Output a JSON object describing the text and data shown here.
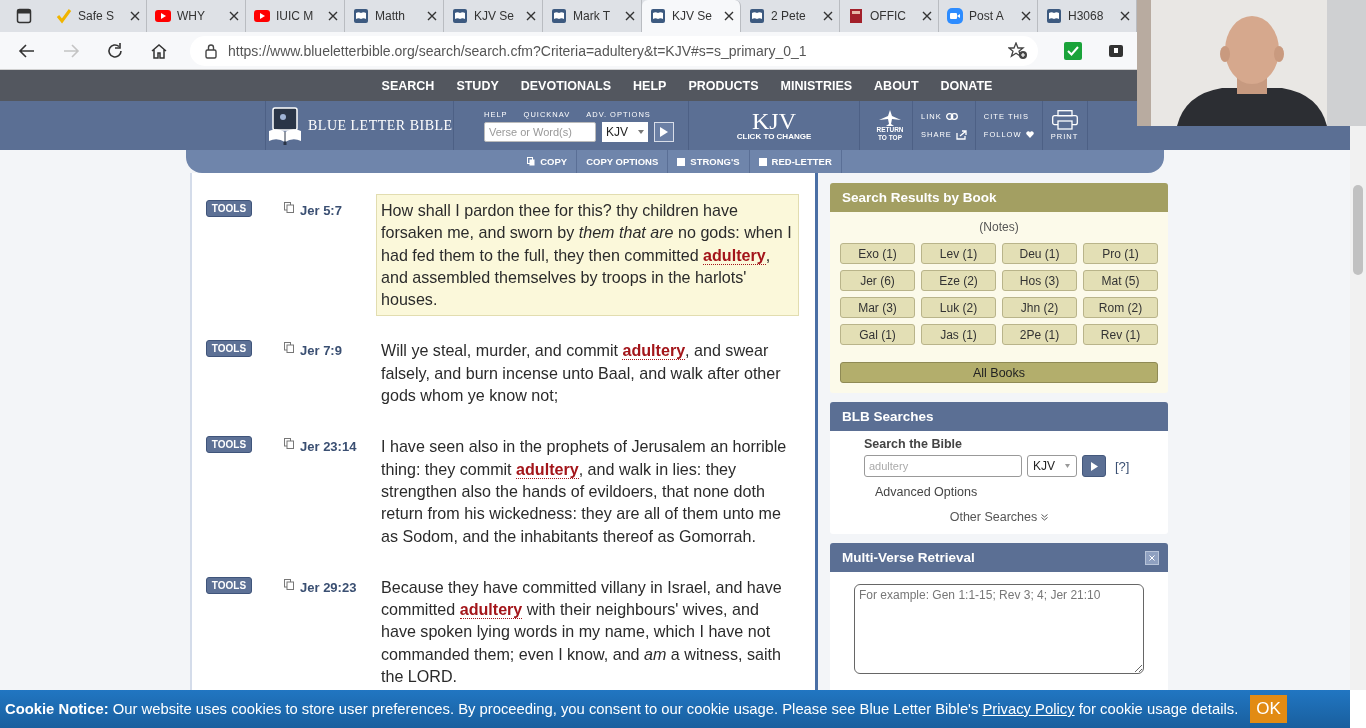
{
  "browser": {
    "tabs": [
      {
        "title": "Safe S",
        "kind": "check",
        "selected": false
      },
      {
        "title": "WHY",
        "kind": "video",
        "selected": false
      },
      {
        "title": "IUIC M",
        "kind": "video",
        "selected": false
      },
      {
        "title": "Matth",
        "kind": "bible",
        "selected": false
      },
      {
        "title": "KJV Se",
        "kind": "bible",
        "selected": false
      },
      {
        "title": "Mark T",
        "kind": "bible",
        "selected": false
      },
      {
        "title": "KJV Se",
        "kind": "bible",
        "selected": true
      },
      {
        "title": "2 Pete",
        "kind": "bible",
        "selected": false
      },
      {
        "title": "OFFIC",
        "kind": "book",
        "selected": false
      },
      {
        "title": "Post A",
        "kind": "meeting",
        "selected": false
      },
      {
        "title": "H3068",
        "kind": "bible",
        "selected": false
      }
    ],
    "url": "https://www.blueletterbible.org/search/search.cfm?Criteria=adultery&t=KJV#s=s_primary_0_1"
  },
  "site_nav": [
    "SEARCH",
    "STUDY",
    "DEVOTIONALS",
    "HELP",
    "PRODUCTS",
    "MINISTRIES",
    "ABOUT",
    "DONATE"
  ],
  "header": {
    "logo": "BLUE LETTER BIBLE",
    "quick_labels": [
      "HELP",
      "QUICKNAV",
      "ADV. OPTIONS"
    ],
    "placeholder": "Verse or Word(s)",
    "version": "KJV",
    "version_big": "KJV",
    "version_sub": "CLICK TO CHANGE",
    "return_to_top": "RETURN TO TOP",
    "link": "LINK",
    "share": "SHARE",
    "cite": "CITE THIS",
    "follow": "FOLLOW",
    "print": "PRINT"
  },
  "toolbar": [
    {
      "label": "COPY",
      "kind": "copy"
    },
    {
      "label": "COPY OPTIONS",
      "kind": "plain"
    },
    {
      "label": "STRONG'S",
      "kind": "checkbox",
      "checked": false
    },
    {
      "label": "RED-LETTER",
      "kind": "checkbox",
      "checked": false
    }
  ],
  "verses": [
    {
      "tools": "TOOLS",
      "ref": "Jer 5:7",
      "highlighted": true,
      "text": "How shall I pardon thee for this? thy children have forsaken me, and sworn by *them that are* no gods: when I had fed them to the full, they then committed **adultery**, and assembled themselves by troops in the harlots' houses."
    },
    {
      "tools": "TOOLS",
      "ref": "Jer 7:9",
      "highlighted": false,
      "text": "Will ye steal, murder, and commit **adultery**, and swear falsely, and burn incense unto Baal, and walk after other gods whom ye know not;"
    },
    {
      "tools": "TOOLS",
      "ref": "Jer 23:14",
      "highlighted": false,
      "text": "I have seen also in the prophets of Jerusalem an horrible thing: they commit **adultery**, and walk in lies: they strengthen also the hands of evildoers, that none doth return from his wickedness: they are all of them unto me as Sodom, and the inhabitants thereof as Gomorrah."
    },
    {
      "tools": "TOOLS",
      "ref": "Jer 29:23",
      "highlighted": false,
      "text": "Because they have committed villany in Israel, and have committed **adultery** with their neighbours' wives, and have spoken lying words in my name, which I have not commanded them; even I know, and *am* a witness, saith the LORD."
    }
  ],
  "results_by_book": {
    "title": "Search Results by Book",
    "notes": "(Notes)",
    "books": [
      "Exo (1)",
      "Lev (1)",
      "Deu (1)",
      "Pro (1)",
      "Jer (6)",
      "Eze (2)",
      "Hos (3)",
      "Mat (5)",
      "Mar (3)",
      "Luk (2)",
      "Jhn (2)",
      "Rom (2)",
      "Gal (1)",
      "Jas (1)",
      "2Pe (1)",
      "Rev (1)"
    ],
    "all": "All Books"
  },
  "blb_searches": {
    "title": "BLB Searches",
    "label": "Search the Bible",
    "placeholder": "adultery",
    "version": "KJV",
    "help": "[?]",
    "advanced": "Advanced Options",
    "other": "Other Searches"
  },
  "multi_verse": {
    "title": "Multi-Verse Retrieval",
    "placeholder": "For example: Gen 1:1-15; Rev 3; 4; Jer 21:10"
  },
  "cookie_notice": {
    "text_before": "**Cookie Notice:** Our website uses cookies to store user preferences. By proceeding, you consent to our cookie usage. Please see Blue Letter Bible's",
    "link": "Privacy Policy",
    "text_after": "for cookie usage details.",
    "button": "OK"
  }
}
